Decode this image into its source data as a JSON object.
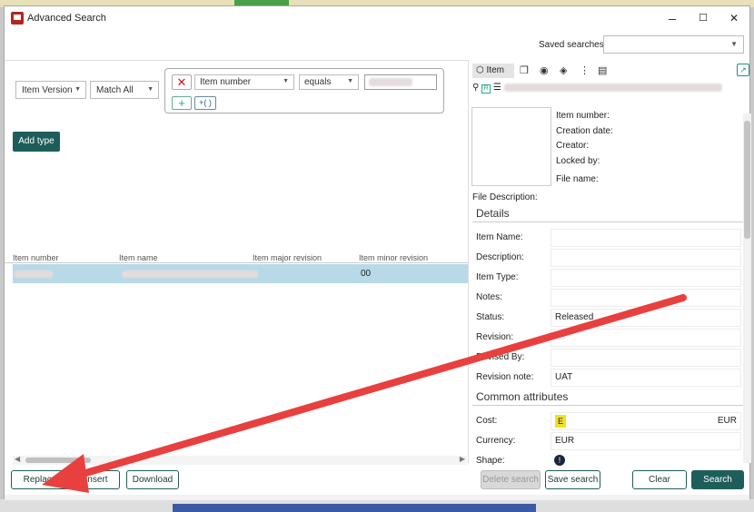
{
  "window": {
    "title": "Advanced Search",
    "minimize": "–",
    "maximize": "☐",
    "close": "✕"
  },
  "saved_searches": {
    "label": "Saved searches",
    "value": ""
  },
  "filters": {
    "item_version": "Item Version",
    "match": "Match All"
  },
  "criteria": {
    "field": "Item number",
    "operator": "equals",
    "remove": "✕",
    "add": "+",
    "group": "+( )"
  },
  "add_type_label": "Add type",
  "table": {
    "columns": [
      "Item number",
      "Item name",
      "Item major revision",
      "Item minor revision"
    ],
    "rows": [
      {
        "minor_revision": "00"
      }
    ]
  },
  "buttons": {
    "replace": "Replace",
    "insert": "Insert",
    "download": "Download",
    "delete_search": "Delete search",
    "save_search": "Save search",
    "clear": "Clear",
    "search": "Search"
  },
  "right_panel": {
    "tab_item": "Item",
    "meta": {
      "item_number": "Item number:",
      "creation_date": "Creation date:",
      "creator": "Creator:",
      "locked_by": "Locked by:",
      "file_name": "File name:"
    },
    "file_description": "File Description:",
    "details_title": "Details",
    "details": [
      {
        "label": "Item Name:",
        "value": ""
      },
      {
        "label": "Description:",
        "value": ""
      },
      {
        "label": "Item Type:",
        "value": ""
      },
      {
        "label": "Notes:",
        "value": ""
      },
      {
        "label": "Status:",
        "value": "Released"
      },
      {
        "label": "Revision:",
        "value": ""
      },
      {
        "label": "Revised By:",
        "value": ""
      },
      {
        "label": "Revision note:",
        "value": "UAT"
      }
    ],
    "common_title": "Common attributes",
    "common": [
      {
        "label": "Cost:",
        "value": "EUR"
      },
      {
        "label": "Currency:",
        "value": "EUR"
      },
      {
        "label": "Shape:",
        "value": ""
      }
    ]
  },
  "colors": {
    "accent": "#1d5e5a",
    "selection": "#b8d9e8",
    "arrow": "#e8403f"
  }
}
